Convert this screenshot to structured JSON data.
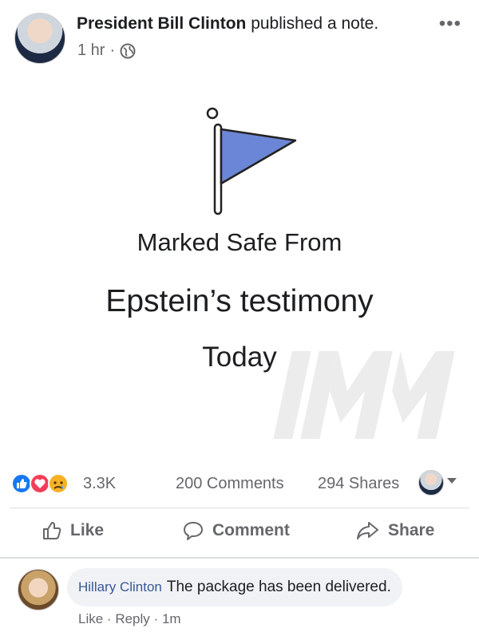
{
  "post": {
    "author": "President Bill Clinton",
    "action_text": "published a note.",
    "time": "1 hr",
    "separator": "·",
    "more": "•••"
  },
  "note": {
    "line1": "Marked Safe From",
    "line2": "Epstein’s testimony",
    "line3": "Today",
    "icon": "flag-icon",
    "flag_color": "#6b86d6"
  },
  "stats": {
    "reactions_count": "3.3K",
    "reaction_icons": [
      "like-icon",
      "love-icon",
      "sad-icon"
    ],
    "comments": "200 Comments",
    "shares": "294 Shares"
  },
  "actions": {
    "like": "Like",
    "comment": "Comment",
    "share": "Share"
  },
  "comment": {
    "author": "Hillary Clinton",
    "text": "The package has been delivered.",
    "like": "Like",
    "reply": "Reply",
    "time": "1m",
    "separator": "·"
  },
  "colors": {
    "link": "#385898",
    "muted": "#65676b",
    "like_blue": "#1877f2",
    "love_red": "#f33e58",
    "sad_yellow": "#f7b125"
  }
}
